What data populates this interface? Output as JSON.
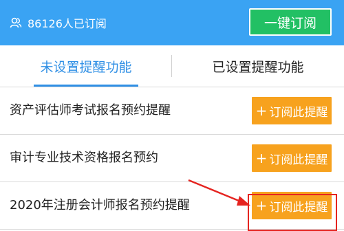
{
  "header": {
    "subscriber_text": "86126人已订阅",
    "one_key_label": "一键订阅",
    "bg_color": "#3aa3f3",
    "button_color": "#22c064"
  },
  "tabs": [
    {
      "label": "未设置提醒功能",
      "active": true
    },
    {
      "label": "已设置提醒功能",
      "active": false
    }
  ],
  "items": [
    {
      "title": "资产评估师考试报名预约提醒",
      "button_label": "订阅此提醒"
    },
    {
      "title": "审计专业技术资格报名预约",
      "button_label": "订阅此提醒"
    },
    {
      "title": "2020年注册会计师报名预约提醒",
      "button_label": "订阅此提醒"
    }
  ],
  "button_plus": "+",
  "accent_color": "#f7a21e",
  "annotation_color": "#e52420"
}
